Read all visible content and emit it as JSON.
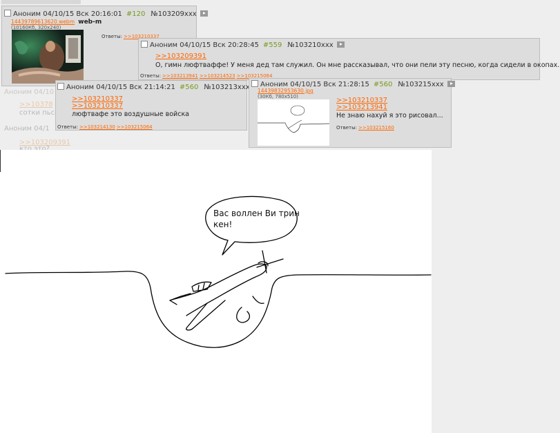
{
  "posts": {
    "p1": {
      "author": "Аноним",
      "datetime": "04/10/15 Вск 20:16:01",
      "num": "#120",
      "id": "№103209xxx",
      "file_name": "14439789613620.webm",
      "file_tag": "web-m",
      "file_meta": "(10160Кб, 320x240)",
      "replies_label": "Ответы:",
      "replies": [
        ">>103210337"
      ]
    },
    "p2": {
      "author": "Аноним",
      "datetime": "04/10/15 Вск 20:28:45",
      "num": "#559",
      "id": "№103210xxx",
      "reflink": ">>103209391",
      "text": "О, гимн люфтваффе! У меня дед там служил. Он мне рассказывал, что они пели эту песню, когда сидели в окопах.",
      "replies_label": "Ответы:",
      "replies": [
        ">>103213941",
        ">>103214523",
        ">>103215064"
      ]
    },
    "p3": {
      "author": "Аноним",
      "datetime": "04/10/15 Вск 21:14:21",
      "num": "#560",
      "id": "№103213xxx",
      "reflinks": [
        ">>103210337",
        ">>103210337"
      ],
      "text": "люфтвафе это воздушные войска",
      "replies_label": "Ответы:",
      "replies": [
        ">>103214130",
        ">>103215064"
      ]
    },
    "p4": {
      "author": "Аноним",
      "datetime": "04/10/15 Вск 21:28:15",
      "num": "#560",
      "id": "№103215xxx",
      "file_name": "14439832953630.jpg",
      "file_meta": "(30Кб, 780x510)",
      "reflinks": [
        ">>103210337",
        ">>103213941"
      ],
      "text": "Не знаю нахуй я это рисовал...",
      "replies_label": "Ответы:",
      "replies": [
        ">>103215160"
      ]
    }
  },
  "background_fragments": {
    "f1": "Аноним 04/10",
    "f2": ">>10378",
    "f3": "сотки пьсон",
    "f4": "Аноним 04/1",
    "f5": ">>103209391",
    "f6": "кто это?"
  },
  "drawing": {
    "bubble_line1": "Вас воллен Ви трин",
    "bubble_line2": "кен!"
  },
  "colors": {
    "post_bg": "#dddddd",
    "link": "#ff6600",
    "post_number": "#789922",
    "page_bg": "#eeeeee"
  }
}
